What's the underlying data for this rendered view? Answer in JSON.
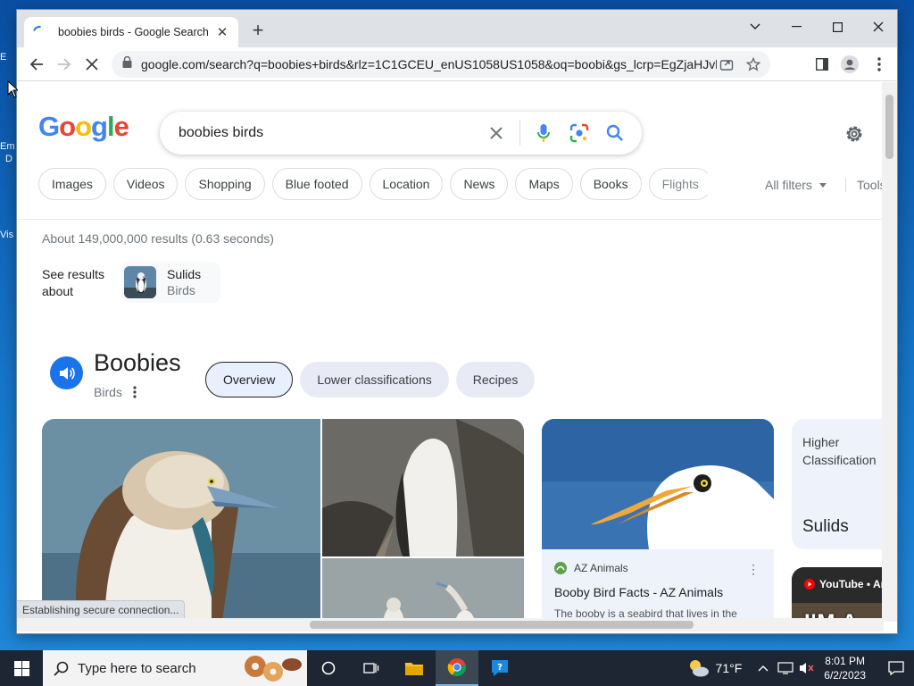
{
  "browser": {
    "tab_title": "boobies birds - Google Search",
    "tab_close": "✕",
    "new_tab": "+",
    "url": "google.com/search?q=boobies+birds&rlz=1C1GCEU_enUS1058US1058&oq=boobi&gs_lcrp=EgZjaHJvbW...",
    "status_text": "Establishing secure connection..."
  },
  "search": {
    "logo_letters": [
      "G",
      "o",
      "o",
      "g",
      "l",
      "e"
    ],
    "query": "boobies birds"
  },
  "filters": {
    "chips": [
      "Images",
      "Videos",
      "Shopping",
      "Blue footed",
      "Location",
      "News",
      "Maps",
      "Books",
      "Flights"
    ],
    "all_filters": "All filters",
    "tools": "Tools"
  },
  "results": {
    "stats": "About 149,000,000 results (0.63 seconds)",
    "see_about": "See results about",
    "entity_name": "Sulids",
    "entity_type": "Birds"
  },
  "knowledge_panel": {
    "title": "Boobies",
    "subtitle": "Birds",
    "tabs": [
      "Overview",
      "Lower classifications",
      "Recipes"
    ],
    "card_source": "AZ Animals",
    "card_title": "Booby Bird Facts - AZ Animals",
    "card_desc": "The booby is a seabird that lives in the coastal regions of Central and South",
    "higher_label": "Higher Classification",
    "higher_value": "Sulids",
    "video_source": "YouTube • An",
    "video_caption": "I'M A"
  },
  "taskbar": {
    "search_placeholder": "Type here to search",
    "weather": "71°F",
    "time": "8:01 PM",
    "date": "6/2/2023"
  },
  "desktop_icons": [
    "E",
    "Em",
    "D",
    "Vis"
  ],
  "colors": {
    "google_blue": "#4285f4",
    "google_red": "#ea4335",
    "google_yellow": "#fbbc05",
    "google_green": "#34a853",
    "accent": "#1a73e8",
    "taskbar": "#1d2632"
  }
}
